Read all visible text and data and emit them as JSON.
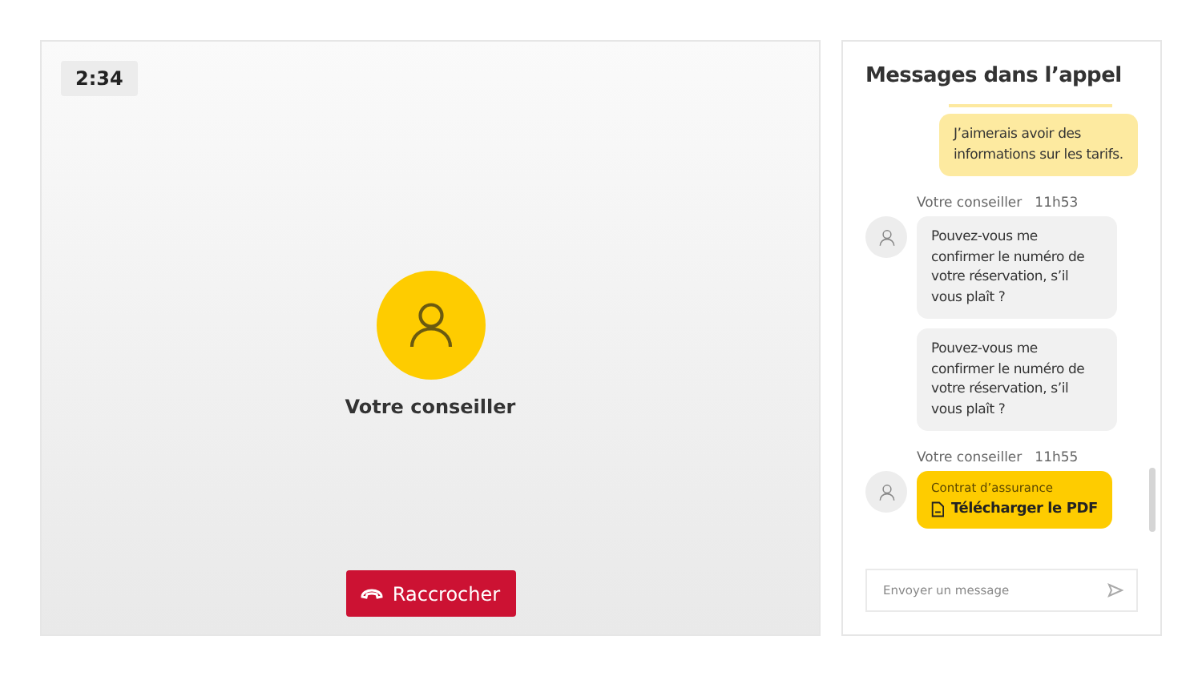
{
  "call": {
    "timer": "2:34",
    "caller_name": "Votre conseiller",
    "hangup_label": "Raccrocher"
  },
  "chat": {
    "title": "Messages dans l’appel",
    "messages": [
      {
        "kind": "sent",
        "text": "J’aimerais avoir des informations sur les tarifs."
      },
      {
        "kind": "received",
        "sender": "Votre conseiller",
        "time": "11h53",
        "avatar": true,
        "text": "Pouvez-vous me confirmer le numéro de votre réservation, s’il vous plaît ?"
      },
      {
        "kind": "received",
        "avatar": false,
        "text": "Pouvez-vous me confirmer le numéro de votre réservation, s’il vous plaît ?"
      },
      {
        "kind": "file",
        "sender": "Votre conseiller",
        "time": "11h55",
        "avatar": true,
        "caption": "Contrat d’assurance",
        "link": "Télécharger le PDF"
      }
    ],
    "input": {
      "placeholder": "Envoyer un message"
    }
  }
}
